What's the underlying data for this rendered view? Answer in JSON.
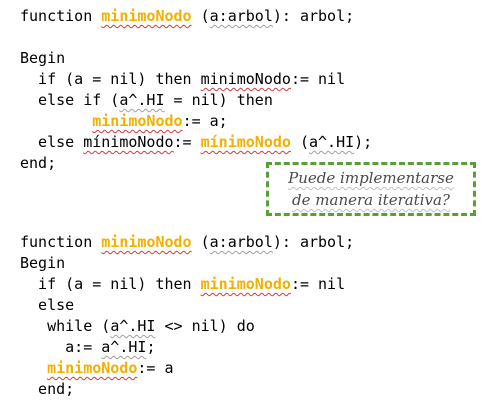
{
  "block1": {
    "l1": {
      "a": "function ",
      "b": "minimoNodo",
      "c": " (",
      "d": "a:arbol",
      "e": "): arbol;"
    },
    "l2": {
      "a": "Begin"
    },
    "l3": {
      "a": "  if (a = nil) then ",
      "b": "minimoNodo",
      "c": ":= nil"
    },
    "l4": {
      "a": "  else if (",
      "b": "a^.HI",
      "c": " = nil) then"
    },
    "l5": {
      "a": "        ",
      "b": "minimoNodo",
      "c": ":= a;"
    },
    "l6": {
      "a": "  else ",
      "b": "mínimoNodo",
      "c": ":= ",
      "d": "mínimoNodo",
      "e": " (",
      "f": "a^.HI",
      "g": ");"
    },
    "l7": {
      "a": "end;"
    }
  },
  "note": {
    "line1": "Puede implementarse",
    "line2": "de manera iterativa?"
  },
  "block2": {
    "l1": {
      "a": "function ",
      "b": "minimoNodo",
      "c": " (",
      "d": "a:arbol",
      "e": "): arbol;"
    },
    "l2": {
      "a": "Begin"
    },
    "l3": {
      "a": "  if (a = nil) then ",
      "b": "minimoNodo",
      "c": ":= nil"
    },
    "l4": {
      "a": "  else"
    },
    "l5": {
      "a": "   while (",
      "b": "a^.HI",
      "c": " <> nil) do"
    },
    "l6": {
      "a": "     a:= ",
      "b": "a^.HI",
      "c": ";"
    },
    "l7": {
      "a": "   ",
      "b": "minimoNodo",
      "c": ":= a"
    },
    "l8": {
      "a": "  end;"
    }
  }
}
